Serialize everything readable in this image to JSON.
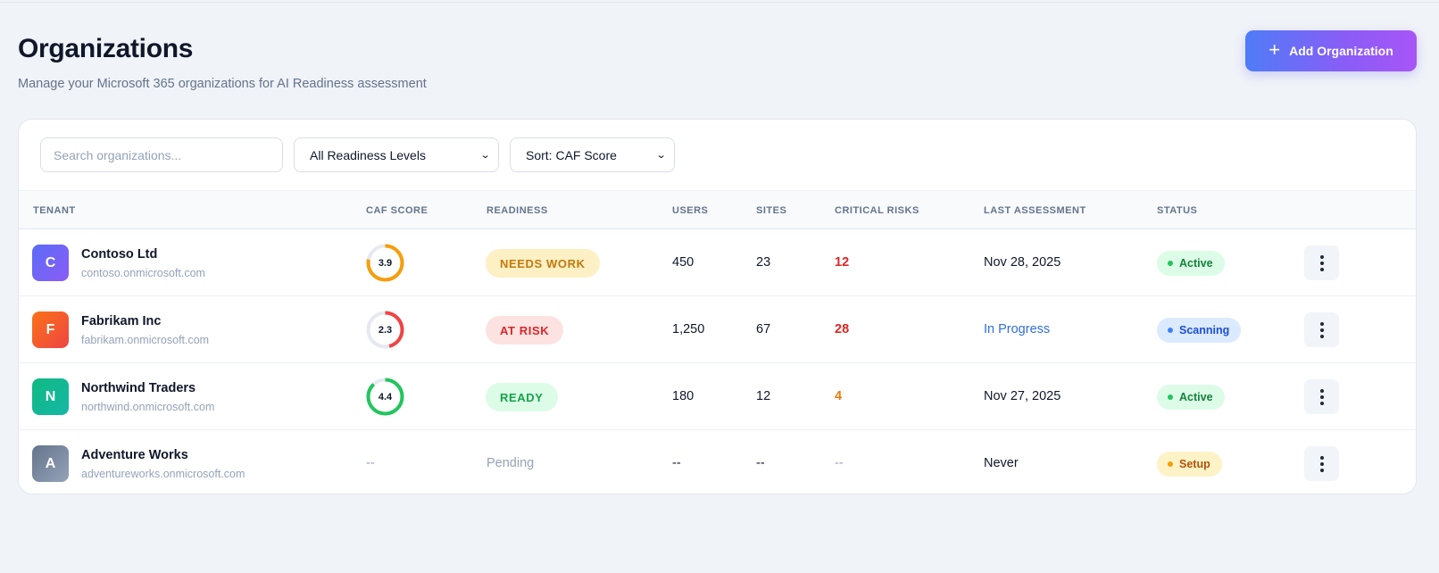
{
  "header": {
    "title": "Organizations",
    "subtitle": "Manage your Microsoft 365 organizations for AI Readiness assessment",
    "add_button_label": "Add Organization",
    "add_button_icon": "plus-icon"
  },
  "filters": {
    "search_placeholder": "Search organizations...",
    "readiness_selected": "All Readiness Levels",
    "sort_selected": "Sort: CAF Score"
  },
  "table": {
    "columns": [
      "TENANT",
      "CAF SCORE",
      "READINESS",
      "USERS",
      "SITES",
      "CRITICAL RISKS",
      "LAST ASSESSMENT",
      "STATUS"
    ],
    "rows": [
      {
        "initial": "C",
        "name": "Contoso Ltd",
        "domain": "contoso.onmicrosoft.com",
        "avatar_colors": [
          "#5b6cf6",
          "#8b5cf6"
        ],
        "caf_score": "3.9",
        "score_fraction": 0.78,
        "ring_color": "#f59e0b",
        "readiness": "NEEDS WORK",
        "readiness_fg": "#c2790a",
        "readiness_bg": "#fdf0c4",
        "users": "450",
        "sites": "23",
        "critical_risks": "12",
        "risk_color": "#dc2626",
        "last_assessment": "Nov 28, 2025",
        "last_color": "#0f172a",
        "status": "Active",
        "status_fg": "#15803d",
        "status_bg": "#dcfce7",
        "status_dot": "#22c55e"
      },
      {
        "initial": "F",
        "name": "Fabrikam Inc",
        "domain": "fabrikam.onmicrosoft.com",
        "avatar_colors": [
          "#f97316",
          "#ef4444"
        ],
        "caf_score": "2.3",
        "score_fraction": 0.46,
        "ring_color": "#ef4444",
        "readiness": "AT RISK",
        "readiness_fg": "#dc2626",
        "readiness_bg": "#fde2e2",
        "users": "1,250",
        "sites": "67",
        "critical_risks": "28",
        "risk_color": "#dc2626",
        "last_assessment": "In Progress",
        "last_color": "#2f6fe0",
        "status": "Scanning",
        "status_fg": "#1d4ed8",
        "status_bg": "#dbeafe",
        "status_dot": "#3b82f6"
      },
      {
        "initial": "N",
        "name": "Northwind Traders",
        "domain": "northwind.onmicrosoft.com",
        "avatar_colors": [
          "#10b981",
          "#14b8a6"
        ],
        "caf_score": "4.4",
        "score_fraction": 0.88,
        "ring_color": "#22c55e",
        "readiness": "READY",
        "readiness_fg": "#16a34a",
        "readiness_bg": "#dcfce7",
        "users": "180",
        "sites": "12",
        "critical_risks": "4",
        "risk_color": "#ea7a0c",
        "last_assessment": "Nov 27, 2025",
        "last_color": "#0f172a",
        "status": "Active",
        "status_fg": "#15803d",
        "status_bg": "#dcfce7",
        "status_dot": "#22c55e"
      },
      {
        "initial": "A",
        "name": "Adventure Works",
        "domain": "adventureworks.onmicrosoft.com",
        "avatar_colors": [
          "#64748b",
          "#94a3b8"
        ],
        "caf_score": "--",
        "score_fraction": null,
        "ring_color": null,
        "readiness": "Pending",
        "readiness_fg": "#94a3b8",
        "readiness_bg": null,
        "users": "--",
        "sites": "--",
        "critical_risks": "--",
        "risk_color": "#94a3b8",
        "last_assessment": "Never",
        "last_color": "#0f172a",
        "status": "Setup",
        "status_fg": "#b45309",
        "status_bg": "#fef3c7",
        "status_dot": "#f59e0b"
      }
    ]
  }
}
